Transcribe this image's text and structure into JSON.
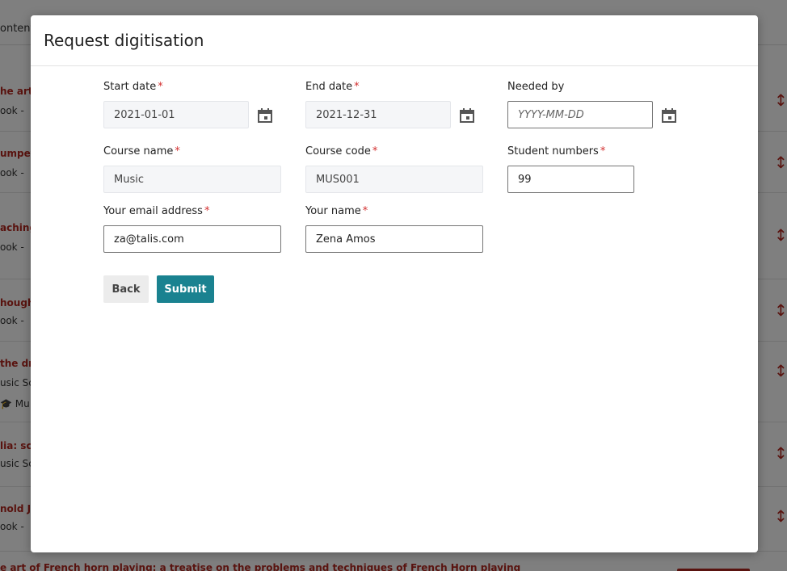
{
  "modal": {
    "title": "Request digitisation",
    "back_label": "Back",
    "submit_label": "Submit"
  },
  "fields": {
    "start_date": {
      "label": "Start date",
      "value": "2021-01-01",
      "required": "*"
    },
    "end_date": {
      "label": "End date",
      "value": "2021-12-31",
      "required": "*"
    },
    "needed_by": {
      "label": "Needed by",
      "placeholder": "YYYY-MM-DD"
    },
    "course_name": {
      "label": "Course name",
      "value": "Music",
      "required": "*"
    },
    "course_code": {
      "label": "Course code",
      "value": "MUS001",
      "required": "*"
    },
    "student_numbers": {
      "label": "Student numbers",
      "value": "99",
      "required": "*"
    },
    "email": {
      "label": "Your email address",
      "value": "za@talis.com",
      "required": "*"
    },
    "name": {
      "label": "Your name",
      "value": "Zena Amos",
      "required": "*"
    }
  },
  "icons": {
    "date_picker": "calendar-icon"
  },
  "colors": {
    "accent": "#1a8290",
    "required": "#d32f2f",
    "link": "#b3261e"
  },
  "background": {
    "topbar_text": "ontent",
    "rows": [
      {
        "title": "he art o",
        "sub": "ook  -"
      },
      {
        "title": "umpet",
        "sub": "ook  -"
      },
      {
        "title": "aching",
        "sub": "ook  -"
      },
      {
        "title": "hought",
        "sub": "ook  -"
      },
      {
        "title": " the dr",
        "sub": "usic Sc",
        "sub2": "Mu"
      },
      {
        "title": "lia: sc",
        "sub": "usic Sc"
      },
      {
        "title": "nold J",
        "sub": "ook  -"
      }
    ],
    "bottom_text": "e art of French horn playing: a treatise on the problems and techniques of French Horn playing"
  }
}
